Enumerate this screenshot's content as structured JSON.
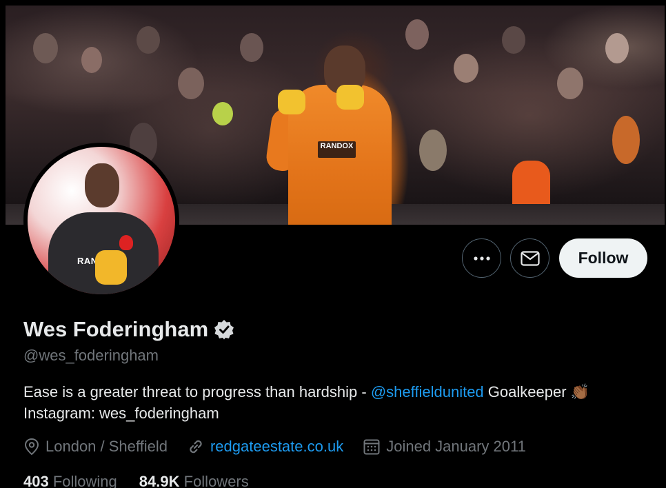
{
  "profile": {
    "display_name": "Wes Foderingham",
    "handle": "@wes_foderingham",
    "verified_icon": "verified-badge-icon",
    "bio": {
      "before": "Ease is a greater threat to progress than hardship - ",
      "mention": "@sheffieldunited",
      "after": " Goalkeeper 👏🏾",
      "line2": "Instagram: wes_foderingham"
    },
    "location": "London / Sheffield",
    "website": "redgateestate.co.uk",
    "joined": "Joined January 2011"
  },
  "stats": {
    "following_count": "403",
    "following_label": "Following",
    "followers_count": "84.9K",
    "followers_label": "Followers"
  },
  "actions": {
    "more_icon": "more-dots-icon",
    "message_icon": "envelope-icon",
    "follow_label": "Follow"
  },
  "banner": {
    "sponsor_text": "RANDOX"
  },
  "avatar": {
    "shirt_text": "RANDOX"
  },
  "colors": {
    "accent": "#1d9bf0",
    "background": "#000000",
    "text_primary": "#e7e9ea",
    "text_secondary": "#71767b"
  }
}
